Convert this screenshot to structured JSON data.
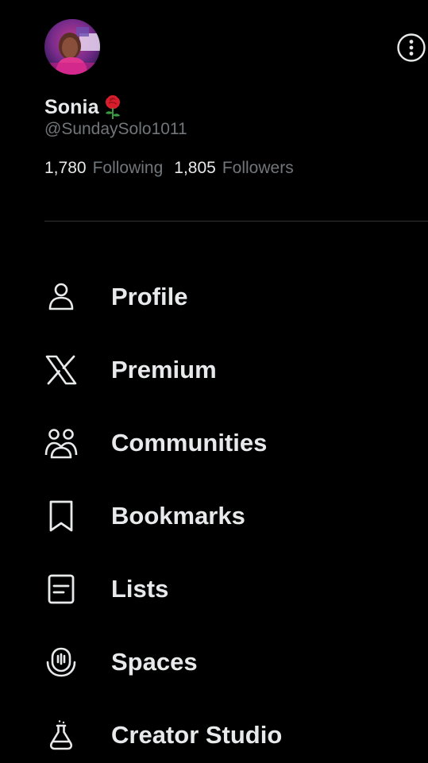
{
  "profile": {
    "display_name": "Sonia",
    "name_emoji": "rose-icon",
    "handle": "@SundaySolo1011",
    "following_count": "1,780",
    "following_label": "Following",
    "followers_count": "1,805",
    "followers_label": "Followers",
    "avatar": "user-avatar"
  },
  "header": {
    "more_icon": "more-options-icon"
  },
  "menu": {
    "items": [
      {
        "label": "Profile",
        "icon": "person-icon"
      },
      {
        "label": "Premium",
        "icon": "x-logo-icon"
      },
      {
        "label": "Communities",
        "icon": "communities-icon"
      },
      {
        "label": "Bookmarks",
        "icon": "bookmark-icon"
      },
      {
        "label": "Lists",
        "icon": "lists-icon"
      },
      {
        "label": "Spaces",
        "icon": "spaces-icon"
      },
      {
        "label": "Creator Studio",
        "icon": "flask-icon"
      }
    ]
  },
  "colors": {
    "background": "#000000",
    "primary_text": "#e7e9ea",
    "secondary_text": "#71767b",
    "divider": "#2f3336"
  }
}
